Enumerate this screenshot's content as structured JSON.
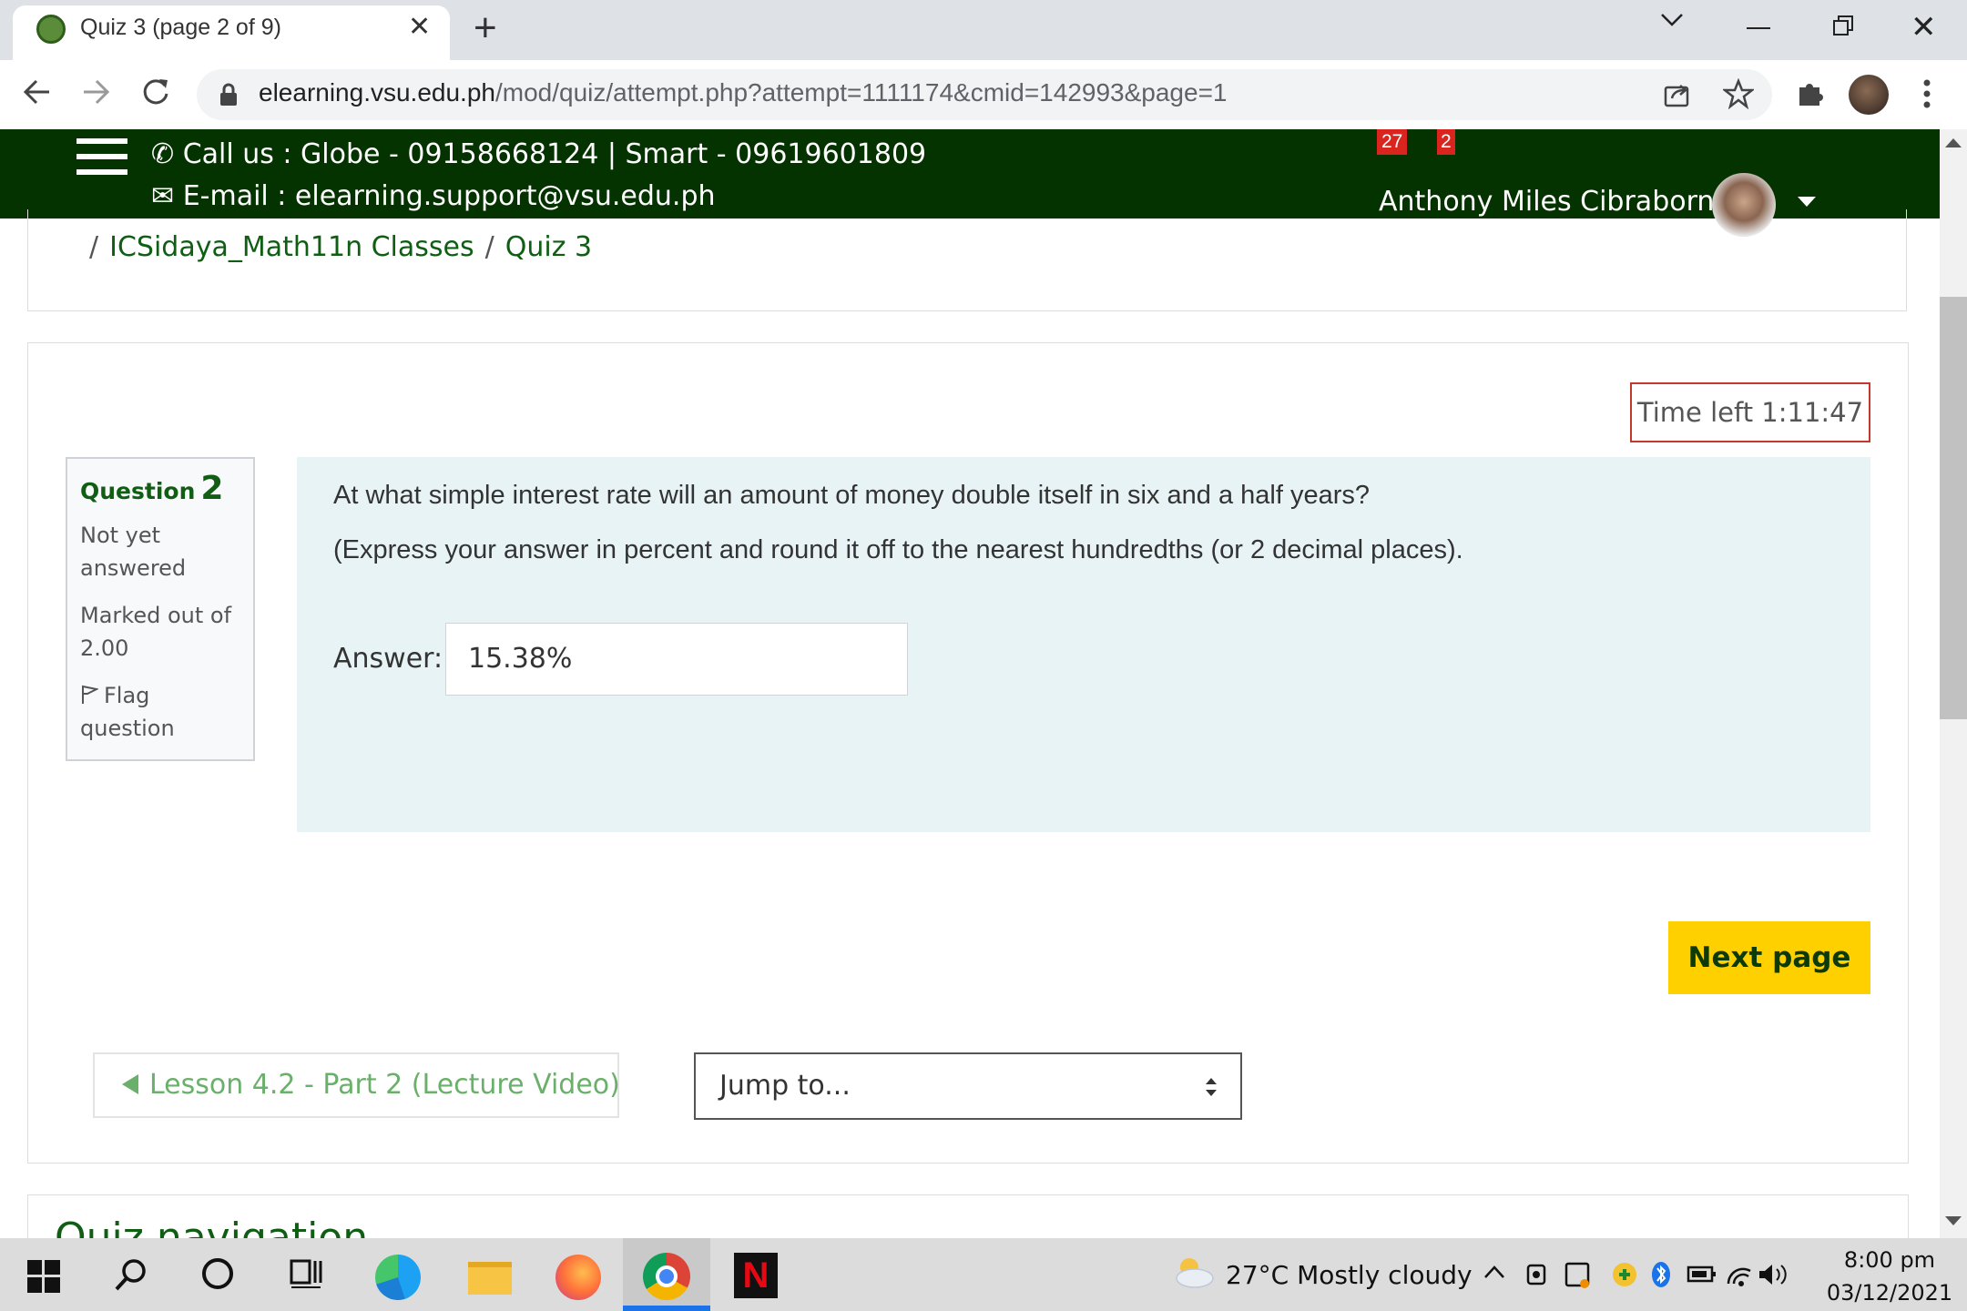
{
  "browser": {
    "tab_title": "Quiz 3 (page 2 of 9)",
    "url_host": "elearning.vsu.edu.ph",
    "url_path": "/mod/quiz/attempt.php?attempt=1111174&cmid=142993&page=1"
  },
  "header": {
    "call_text": "Call us : Globe - 09158668124 | Smart - 09619601809",
    "email_text": "E-mail : elearning.support@vsu.edu.ph",
    "notifications_count": "27",
    "messages_count": "2",
    "user_name": "Anthony Miles Cibraborn",
    "brand_color": "#053300"
  },
  "breadcrumb": {
    "items": [
      "ICSidaya_Math11n Classes",
      "Quiz 3"
    ]
  },
  "quiz": {
    "timer": "Time left 1:11:47",
    "question_label": "Question",
    "question_number": "2",
    "state": "Not yet answered",
    "marked": "Marked out of 2.00",
    "flag": "Flag question",
    "text_line1": "At what simple interest rate will an amount of money double itself in six and a half years?",
    "text_line2": "(Express your answer in percent and round it off to the nearest hundredths (or 2 decimal places).",
    "answer_label": "Answer:",
    "answer_value": "15.38%",
    "next_button": "Next page",
    "prev_activity": "Lesson 4.2 - Part 2 (Lecture Video)",
    "jump_to": "Jump to...",
    "next_card_title": "Quiz navigation"
  },
  "taskbar": {
    "weather": "27°C  Mostly cloudy",
    "time": "8:00 pm",
    "date": "03/12/2021"
  }
}
